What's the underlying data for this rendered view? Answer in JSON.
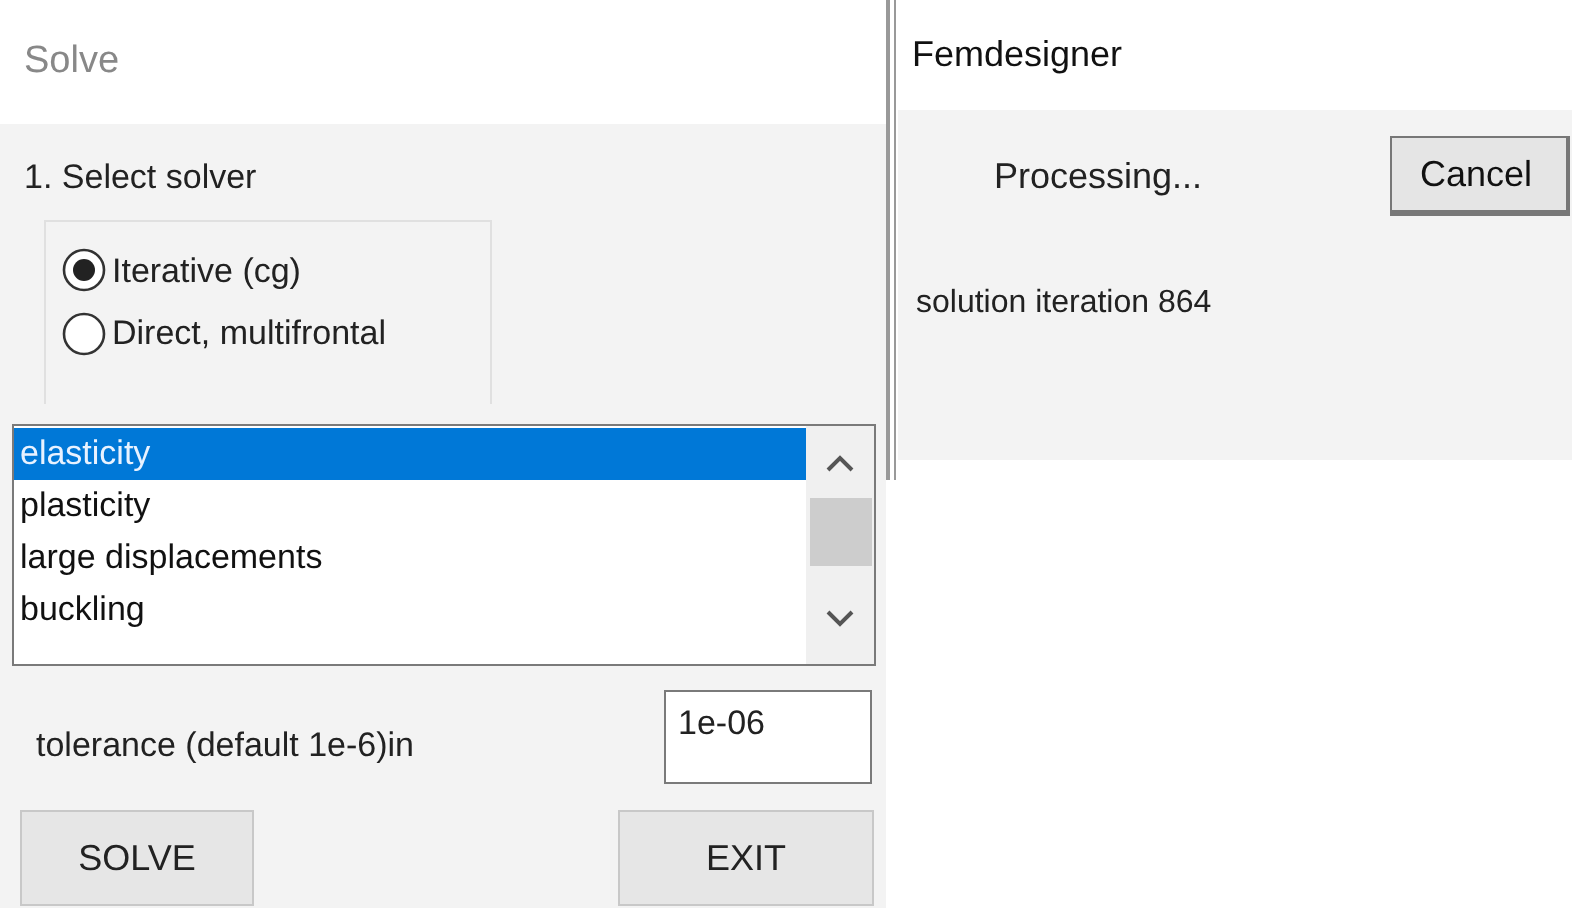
{
  "solve_panel": {
    "title": "Solve",
    "section_label": "1. Select solver",
    "solvers": [
      {
        "label": "Iterative (cg)",
        "selected": true
      },
      {
        "label": "Direct, multifrontal",
        "selected": false
      }
    ],
    "analysis_list": [
      {
        "label": "elasticity",
        "selected": true
      },
      {
        "label": "plasticity",
        "selected": false
      },
      {
        "label": "large displacements",
        "selected": false
      },
      {
        "label": "buckling",
        "selected": false
      }
    ],
    "tolerance": {
      "label": "tolerance (default 1e-6)in",
      "value": "1e-06"
    },
    "buttons": [
      "SOLVE",
      "EXIT"
    ]
  },
  "progress_dialog": {
    "title": "Femdesigner",
    "status": "Processing...",
    "cancel_button": "Cancel",
    "message": "solution iteration 864"
  }
}
